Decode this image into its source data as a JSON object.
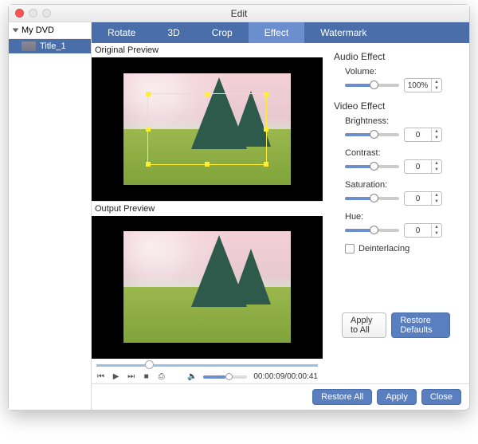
{
  "window": {
    "title": "Edit"
  },
  "sidebar": {
    "root": "My DVD",
    "items": [
      {
        "label": "Title_1"
      }
    ]
  },
  "tabs": [
    {
      "label": "Rotate",
      "active": false
    },
    {
      "label": "3D",
      "active": false
    },
    {
      "label": "Crop",
      "active": false
    },
    {
      "label": "Effect",
      "active": true
    },
    {
      "label": "Watermark",
      "active": false
    }
  ],
  "previews": {
    "original_label": "Original Preview",
    "output_label": "Output Preview"
  },
  "playback": {
    "time": "00:00:09/00:00:41",
    "icons": {
      "prev": "⏮",
      "play": "▶",
      "next": "⏭",
      "stop": "■",
      "snap": "⎙",
      "vol": "🔈"
    }
  },
  "panel": {
    "audio_title": "Audio Effect",
    "volume_label": "Volume:",
    "volume_value": "100%",
    "video_title": "Video Effect",
    "brightness_label": "Brightness:",
    "brightness_value": "0",
    "contrast_label": "Contrast:",
    "contrast_value": "0",
    "saturation_label": "Saturation:",
    "saturation_value": "0",
    "hue_label": "Hue:",
    "hue_value": "0",
    "deinterlace_label": "Deinterlacing"
  },
  "buttons": {
    "apply_all": "Apply to All",
    "restore_defaults": "Restore Defaults",
    "restore_all": "Restore All",
    "apply": "Apply",
    "close": "Close"
  }
}
